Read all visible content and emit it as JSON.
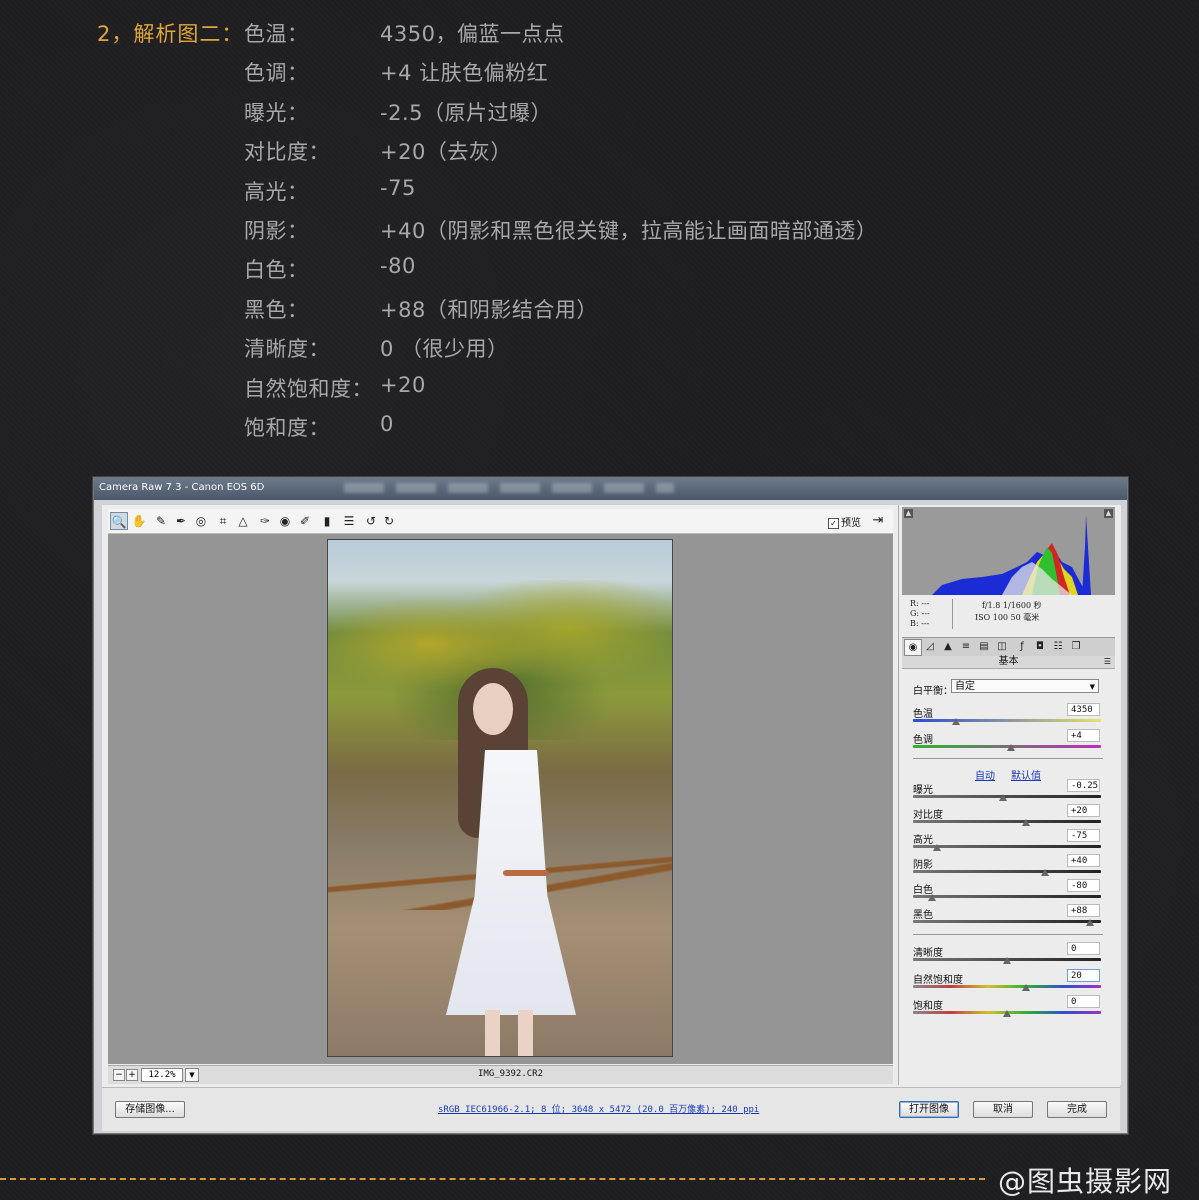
{
  "heading": "2，解析图二：",
  "settings": [
    {
      "label": "色温：",
      "value": "4350，偏蓝一点点"
    },
    {
      "label": "色调：",
      "value": "+4  让肤色偏粉红"
    },
    {
      "label": "曝光：",
      "value": " -2.5（原片过曝）"
    },
    {
      "label": "对比度：",
      "value": "+20（去灰）"
    },
    {
      "label": "高光：",
      "value": "-75"
    },
    {
      "label": "阴影：",
      "value": "+40（阴影和黑色很关键，拉高能让画面暗部通透）"
    },
    {
      "label": "白色：",
      "value": " -80"
    },
    {
      "label": "黑色：",
      "value": "+88（和阴影结合用）"
    },
    {
      "label": "清晰度：",
      "value": " 0 （很少用）"
    },
    {
      "label": "自然饱和度：",
      "value": "+20"
    },
    {
      "label": "饱和度：",
      "value": " 0"
    }
  ],
  "window": {
    "title": "Camera Raw 7.3 -  Canon EOS 6D",
    "preview_label": "预览",
    "preview_checked": "✓",
    "zoom": "12.2%",
    "filename": "IMG_9392.CR2",
    "save_button": "存储图像...",
    "info_link": "sRGB IEC61966-2.1; 8 位; 3648 x 5472 (20.0 百万像素); 240 ppi",
    "open_button": "打开图像",
    "cancel_button": "取消",
    "done_button": "完成"
  },
  "readout": {
    "r": "R:  ---",
    "g": "G:  ---",
    "b": "B:  ---",
    "exif_line1": "f/1.8   1/1600 秒",
    "exif_line2": "ISO 100   50 毫米"
  },
  "panel": {
    "section_title": "基本",
    "wb_label": "白平衡：",
    "wb_value": "自定",
    "auto_link": "自动",
    "default_link": "默认值",
    "sliders": [
      {
        "name": "色温",
        "value": "4350",
        "pos": 0.23
      },
      {
        "name": "色调",
        "value": "+4",
        "pos": 0.52
      },
      {
        "name": "曝光",
        "value": "-0.25",
        "pos": 0.48
      },
      {
        "name": "对比度",
        "value": "+20",
        "pos": 0.6
      },
      {
        "name": "高光",
        "value": "-75",
        "pos": 0.13
      },
      {
        "name": "阴影",
        "value": "+40",
        "pos": 0.7
      },
      {
        "name": "白色",
        "value": "-80",
        "pos": 0.1
      },
      {
        "name": "黑色",
        "value": "+88",
        "pos": 0.94
      },
      {
        "name": "清晰度",
        "value": "0",
        "pos": 0.5
      },
      {
        "name": "自然饱和度",
        "value": "20",
        "pos": 0.6
      },
      {
        "name": "饱和度",
        "value": "0",
        "pos": 0.5
      }
    ]
  },
  "watermark": "@图虫摄影网",
  "colors": {
    "accent": "#e0a63a",
    "text": "#a8a8a8",
    "background": "#1d1d20",
    "link": "#1a3ab4"
  }
}
